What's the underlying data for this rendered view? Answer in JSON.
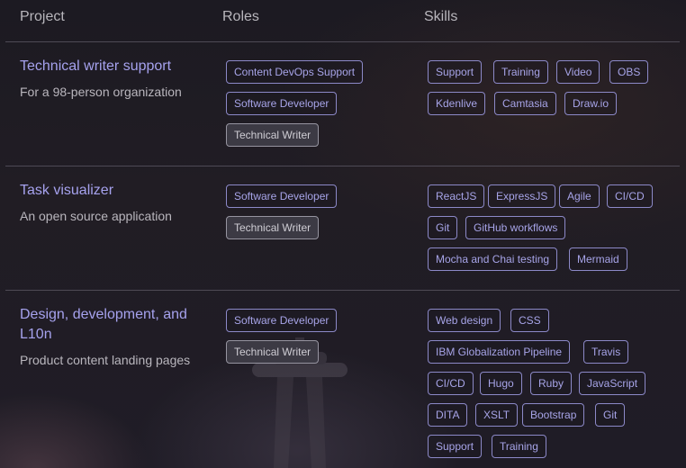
{
  "header": {
    "project": "Project",
    "roles": "Roles",
    "skills": "Skills"
  },
  "projects": [
    {
      "title": "Technical writer support",
      "subtitle": "For a 98-person organization",
      "roles": [
        "Content DevOps Support",
        "Software Developer",
        "Technical Writer"
      ],
      "skills": [
        "Support",
        "Training",
        "Video",
        "OBS",
        "Kdenlive",
        "Camtasia",
        "Draw.io"
      ]
    },
    {
      "title": "Task visualizer",
      "subtitle": "An open source application",
      "roles": [
        "Software Developer",
        "Technical Writer"
      ],
      "skills": [
        "ReactJS",
        "ExpressJS",
        "Agile",
        "CI/CD",
        "Git",
        "GitHub workflows",
        "Mocha and Chai testing",
        "Mermaid"
      ]
    },
    {
      "title": "Design, development, and L10n",
      "subtitle": "Product content landing pages",
      "roles": [
        "Software Developer",
        "Technical Writer"
      ],
      "skills": [
        "Web design",
        "CSS",
        "IBM Globalization Pipeline",
        "Travis",
        "CI/CD",
        "Hugo",
        "Ruby",
        "JavaScript",
        "DITA",
        "XSLT",
        "Bootstrap",
        "Git",
        "Support",
        "Training"
      ]
    }
  ],
  "selected_role": "Technical Writer",
  "colors": {
    "link": "#a6a2ee",
    "tag_border": "#8c89c8",
    "selected_bg": "#3c3a44"
  }
}
